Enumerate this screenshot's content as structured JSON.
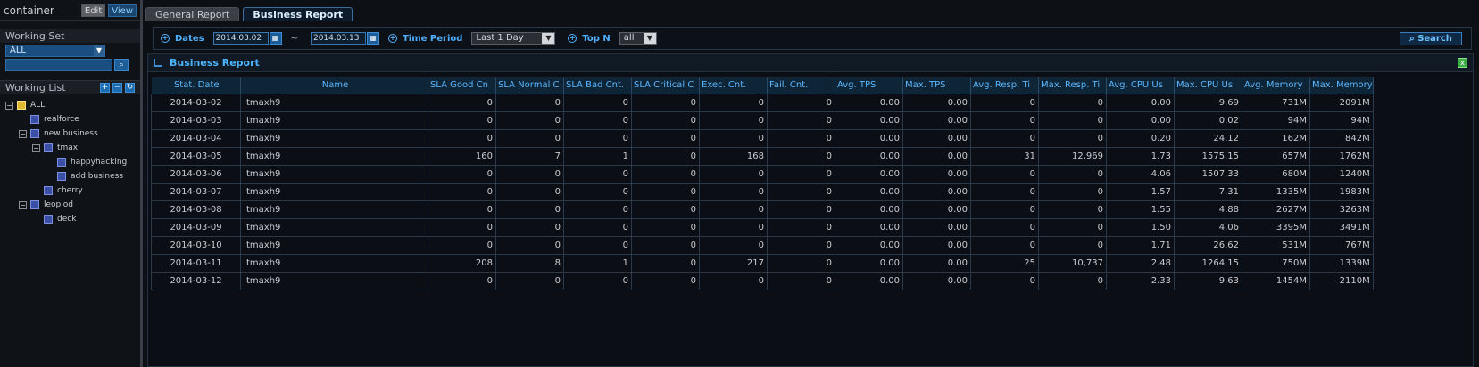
{
  "sidebar": {
    "title": "container",
    "edit_label": "Edit",
    "view_label": "View",
    "working_set_title": "Working Set",
    "working_set_value": "ALL",
    "working_list_title": "Working List",
    "tree": [
      {
        "label": "ALL",
        "depth": 0,
        "toggle": "−",
        "root": true
      },
      {
        "label": "realforce",
        "depth": 1,
        "toggle": ""
      },
      {
        "label": "new business",
        "depth": 1,
        "toggle": "−"
      },
      {
        "label": "tmax",
        "depth": 2,
        "toggle": "−"
      },
      {
        "label": "happyhacking",
        "depth": 3,
        "toggle": ""
      },
      {
        "label": "add business",
        "depth": 3,
        "toggle": ""
      },
      {
        "label": "cherry",
        "depth": 2,
        "toggle": ""
      },
      {
        "label": "leoplod",
        "depth": 1,
        "toggle": "−"
      },
      {
        "label": "deck",
        "depth": 2,
        "toggle": ""
      }
    ]
  },
  "tabs": [
    {
      "label": "General Report",
      "active": false
    },
    {
      "label": "Business Report",
      "active": true
    }
  ],
  "filters": {
    "dates_label": "Dates",
    "date_from": "2014.03.02",
    "date_to": "2014.03.13",
    "dash": "~",
    "time_period_label": "Time Period",
    "time_period_value": "Last 1 Day",
    "topn_label": "Top N",
    "topn_value": "all",
    "search_label": "Search"
  },
  "panel": {
    "title": "Business Report"
  },
  "table": {
    "columns": [
      "Stat. Date",
      "Name",
      "SLA Good Cn",
      "SLA Normal C",
      "SLA Bad Cnt.",
      "SLA Critical C",
      "Exec. Cnt.",
      "Fail. Cnt.",
      "Avg. TPS",
      "Max. TPS",
      "Avg. Resp. Ti",
      "Max. Resp. Ti",
      "Avg. CPU Us",
      "Max. CPU Us",
      "Avg. Memory",
      "Max. Memory"
    ],
    "rows": [
      [
        "2014-03-02",
        "tmaxh9",
        "0",
        "0",
        "0",
        "0",
        "0",
        "0",
        "0.00",
        "0.00",
        "0",
        "0",
        "0.00",
        "9.69",
        "731M",
        "2091M"
      ],
      [
        "2014-03-03",
        "tmaxh9",
        "0",
        "0",
        "0",
        "0",
        "0",
        "0",
        "0.00",
        "0.00",
        "0",
        "0",
        "0.00",
        "0.02",
        "94M",
        "94M"
      ],
      [
        "2014-03-04",
        "tmaxh9",
        "0",
        "0",
        "0",
        "0",
        "0",
        "0",
        "0.00",
        "0.00",
        "0",
        "0",
        "0.20",
        "24.12",
        "162M",
        "842M"
      ],
      [
        "2014-03-05",
        "tmaxh9",
        "160",
        "7",
        "1",
        "0",
        "168",
        "0",
        "0.00",
        "0.00",
        "31",
        "12,969",
        "1.73",
        "1575.15",
        "657M",
        "1762M"
      ],
      [
        "2014-03-06",
        "tmaxh9",
        "0",
        "0",
        "0",
        "0",
        "0",
        "0",
        "0.00",
        "0.00",
        "0",
        "0",
        "4.06",
        "1507.33",
        "680M",
        "1240M"
      ],
      [
        "2014-03-07",
        "tmaxh9",
        "0",
        "0",
        "0",
        "0",
        "0",
        "0",
        "0.00",
        "0.00",
        "0",
        "0",
        "1.57",
        "7.31",
        "1335M",
        "1983M"
      ],
      [
        "2014-03-08",
        "tmaxh9",
        "0",
        "0",
        "0",
        "0",
        "0",
        "0",
        "0.00",
        "0.00",
        "0",
        "0",
        "1.55",
        "4.88",
        "2627M",
        "3263M"
      ],
      [
        "2014-03-09",
        "tmaxh9",
        "0",
        "0",
        "0",
        "0",
        "0",
        "0",
        "0.00",
        "0.00",
        "0",
        "0",
        "1.50",
        "4.06",
        "3395M",
        "3491M"
      ],
      [
        "2014-03-10",
        "tmaxh9",
        "0",
        "0",
        "0",
        "0",
        "0",
        "0",
        "0.00",
        "0.00",
        "0",
        "0",
        "1.71",
        "26.62",
        "531M",
        "767M"
      ],
      [
        "2014-03-11",
        "tmaxh9",
        "208",
        "8",
        "1",
        "0",
        "217",
        "0",
        "0.00",
        "0.00",
        "25",
        "10,737",
        "2.48",
        "1264.15",
        "750M",
        "1339M"
      ],
      [
        "2014-03-12",
        "tmaxh9",
        "0",
        "0",
        "0",
        "0",
        "0",
        "0",
        "0.00",
        "0.00",
        "0",
        "0",
        "2.33",
        "9.63",
        "1454M",
        "2110M"
      ]
    ]
  }
}
